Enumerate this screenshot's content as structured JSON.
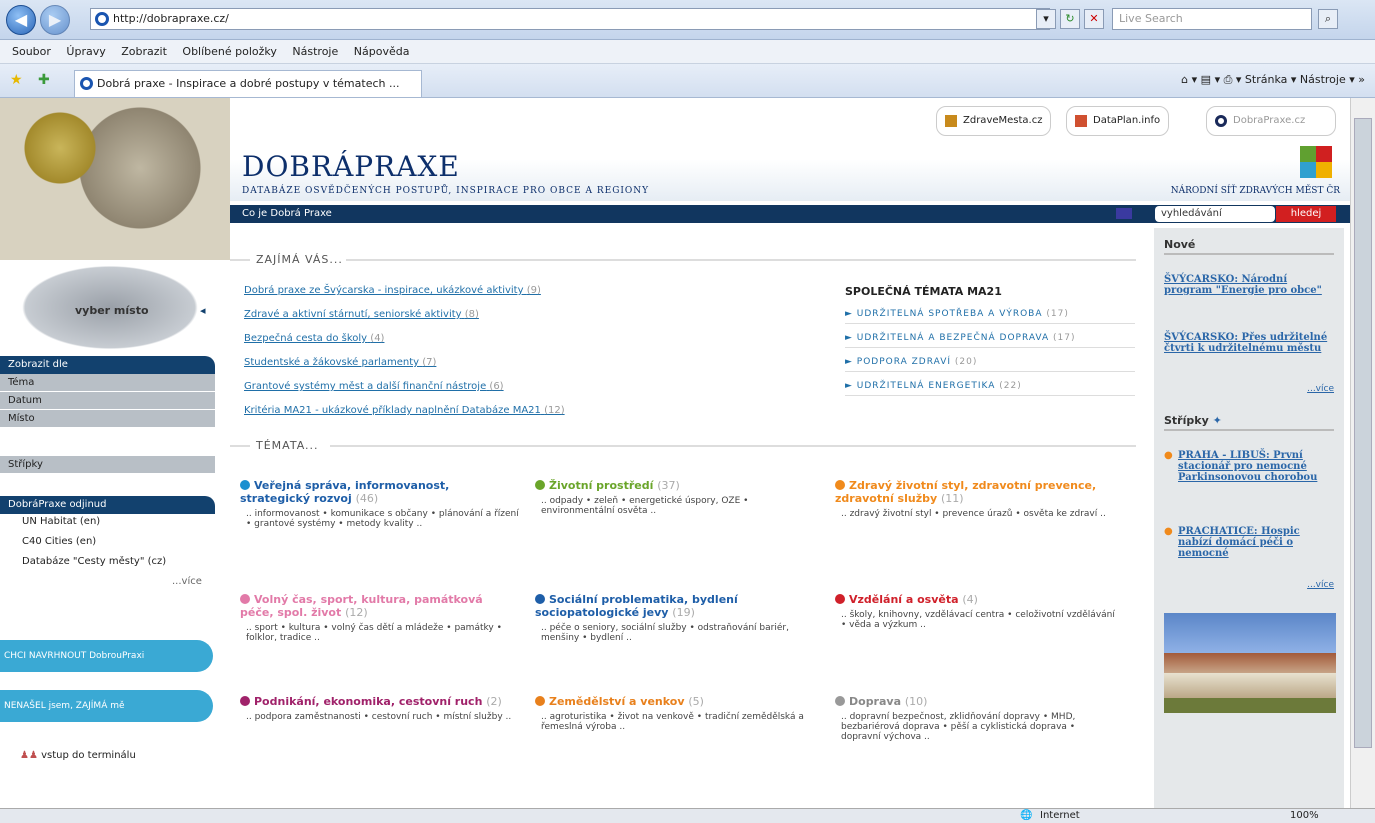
{
  "browser": {
    "url": "http://dobrapraxe.cz/",
    "search_placeholder": "Live Search",
    "menu": [
      "Soubor",
      "Úpravy",
      "Zobrazit",
      "Oblíbené položky",
      "Nástroje",
      "Nápověda"
    ],
    "tab_title": "Dobrá praxe - Inspirace a dobré postupy v tématech ...",
    "toolbar": {
      "page": "Stránka",
      "tools": "Nástroje"
    },
    "status": {
      "zone": "Internet",
      "zoom": "100%"
    }
  },
  "header": {
    "logo": "DOBRÁPRAXE",
    "tagline": "DATABÁZE OSVĚDČENÝCH POSTUPŮ, INSPIRACE PRO OBCE A REGIONY",
    "network": "NÁRODNÍ SÍŤ ZDRAVÝCH MĚST ČR",
    "ext_links": [
      "ZdraveMesta.cz",
      "DataPlan.info",
      "DobraPraxe.cz"
    ],
    "nav_label": "Co je Dobrá Praxe",
    "search_value": "vyhledávání",
    "search_button": "hledej"
  },
  "left": {
    "map_label": "vyber místo",
    "display_by": "Zobrazit dle",
    "display_items": [
      "Téma",
      "Datum",
      "Místo"
    ],
    "strips": "Střípky",
    "elsewhere_head": "DobráPraxe odjinud",
    "elsewhere": [
      "UN Habitat (en)",
      "C40 Cities (en)",
      "Databáze \"Cesty městy\" (cz)"
    ],
    "more": "...více",
    "pill1": "CHCI NAVRHNOUT DobrouPraxi",
    "pill2": "NENAŠEL jsem, ZAJÍMÁ mě",
    "terminal": "vstup do terminálu"
  },
  "main": {
    "interest_heading": "ZAJÍMÁ VÁS...",
    "interest_links": [
      {
        "text": "Dobrá praxe ze Švýcarska - inspirace, ukázkové aktivity",
        "count": "(9)"
      },
      {
        "text": "Zdravé a aktivní stárnutí, seniorské aktivity",
        "count": "(8)"
      },
      {
        "text": "Bezpečná cesta do školy",
        "count": "(4)"
      },
      {
        "text": "Studentské a žákovské parlamenty",
        "count": "(7)"
      },
      {
        "text": "Grantové systémy měst a další finanční nástroje",
        "count": "(6)"
      },
      {
        "text": "Kritéria MA21 - ukázkové příklady naplnění Databáze MA21",
        "count": "(12)"
      }
    ],
    "ma21_heading": "SPOLEČNÁ TÉMATA MA21",
    "ma21": [
      {
        "text": "► UDRŽITELNÁ SPOTŘEBA A VÝROBA",
        "count": "(17)"
      },
      {
        "text": "► UDRŽITELNÁ A BEZPEČNÁ DOPRAVA",
        "count": "(17)"
      },
      {
        "text": "► PODPORA ZDRAVÍ",
        "count": "(20)"
      },
      {
        "text": "► UDRŽITELNÁ ENERGETIKA",
        "count": "(22)"
      }
    ],
    "topics_heading": "TÉMATA...",
    "topics": [
      {
        "title": "Veřejná správa, informovanost, strategický rozvoj",
        "count": "(46)",
        "color": "#1a8fd0",
        "desc": ".. informovanost • komunikace s občany • plánování a řízení • grantové systémy • metody kvality .."
      },
      {
        "title": "Životní prostředí",
        "count": "(37)",
        "color": "#6aa52a",
        "desc": ".. odpady • zeleň • energetické úspory, OZE • environmentální osvěta .."
      },
      {
        "title": "Zdravý životní styl, zdravotní prevence, zdravotní služby",
        "count": "(11)",
        "color": "#f08a1c",
        "desc": ".. zdravý životní styl • prevence úrazů • osvěta ke zdraví .."
      },
      {
        "title": "Volný čas, sport, kultura, památková péče, spol. život",
        "count": "(12)",
        "color": "#e27aa8",
        "desc": ".. sport • kultura • volný čas dětí a mládeže • památky • folklor, tradice .."
      },
      {
        "title": "Sociální problematika, bydlení sociopatologické jevy",
        "count": "(19)",
        "color": "#1e5ea8",
        "desc": ".. péče o seniory, sociální služby • odstraňování bariér, menšiny • bydlení .."
      },
      {
        "title": "Vzdělání a osvěta",
        "count": "(4)",
        "color": "#d0202a",
        "desc": ".. školy, knihovny, vzdělávací centra • celoživotní vzdělávání • věda a výzkum .."
      },
      {
        "title": "Podnikání, ekonomika, cestovní ruch",
        "count": "(2)",
        "color": "#a0226a",
        "desc": ".. podpora zaměstnanosti • cestovní ruch • místní služby .."
      },
      {
        "title": "Zemědělství a venkov",
        "count": "(5)",
        "color": "#e8801c",
        "desc": ".. agroturistika • život na venkově • tradiční zemědělská a řemeslná výroba .."
      },
      {
        "title": "Doprava",
        "count": "(10)",
        "color": "#999999",
        "desc": ".. dopravní bezpečnost, zklidňování dopravy • MHD, bezbariérová doprava • pěší a cyklistická doprava • dopravní výchova .."
      }
    ]
  },
  "right": {
    "new_heading": "Nové",
    "news": [
      "ŠVÝCARSKO: Národní program \"Energie pro obce\"",
      "ŠVÝCARSKO: Přes udržitelné čtvrti k udržitelnému městu"
    ],
    "more": "...více",
    "strips_heading": "Střípky",
    "strips": [
      "PRAHA - LIBUŠ: První stacionář pro nemocné Parkinsonovou chorobou",
      "PRACHATICE: Hospic nabízí domácí péči o nemocné"
    ]
  }
}
